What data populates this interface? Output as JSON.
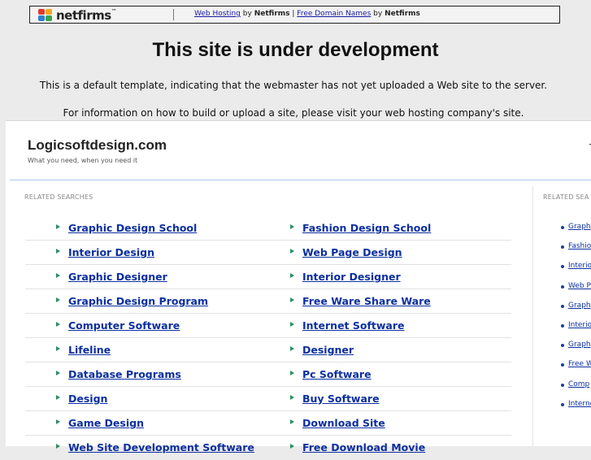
{
  "banner": {
    "logo_text": "netfirms",
    "logo_tm": "™",
    "link1": "Web Hosting",
    "by1": "by",
    "brand1": "Netfirms",
    "sep": "|",
    "link2": "Free Domain Names",
    "by2": "by",
    "brand2": "Netfirms"
  },
  "headline": "This site is under development",
  "info_line1": "This is a default template, indicating that the webmaster has not yet uploaded a Web site to the server.",
  "info_line2": "For information on how to build or upload a site, please visit your web hosting company's site.",
  "site": {
    "title": "Logicsoftdesign.com",
    "tagline": "What you need, when you need it"
  },
  "related_label_left": "RELATED SEARCHES",
  "related_label_right": "RELATED SEA",
  "results": [
    [
      "Graphic Design School",
      "Fashion Design School"
    ],
    [
      "Interior Design",
      "Web Page Design"
    ],
    [
      "Graphic Designer",
      "Interior Designer"
    ],
    [
      "Graphic Design Program",
      "Free Ware Share Ware"
    ],
    [
      "Computer Software",
      "Internet Software"
    ],
    [
      "Lifeline",
      "Designer"
    ],
    [
      "Database Programs",
      "Pc Software"
    ],
    [
      "Design",
      "Buy Software"
    ],
    [
      "Game Design",
      "Download Site"
    ],
    [
      "Web Site Development Software",
      "Free Download Movie"
    ]
  ],
  "side_links": [
    "Graph",
    "Fashio",
    "Interio",
    "Web P",
    "Graph",
    "Interio",
    "Graph",
    "Free W",
    "Comp",
    "Interne"
  ],
  "colors": {
    "link": "#0b2fa0",
    "arrow": "#2c8e63",
    "rule": "#a9c6ea"
  }
}
